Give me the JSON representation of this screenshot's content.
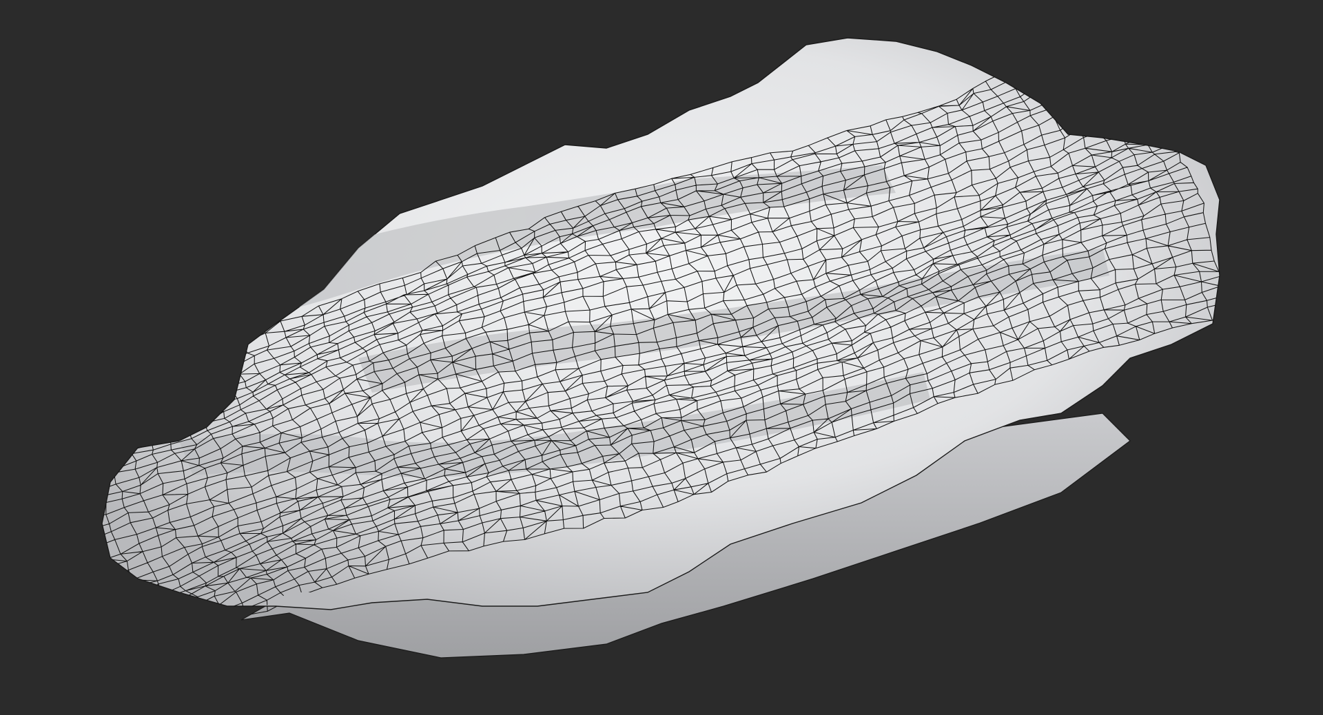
{
  "scene": {
    "background_color": "#2b2b2b",
    "surface_color": "#e6e7e8",
    "wireframe_color": "#111111",
    "shadow_color": "#9a9b9d",
    "highlight_color": "#f3f4f5",
    "object": "rock-mesh"
  }
}
